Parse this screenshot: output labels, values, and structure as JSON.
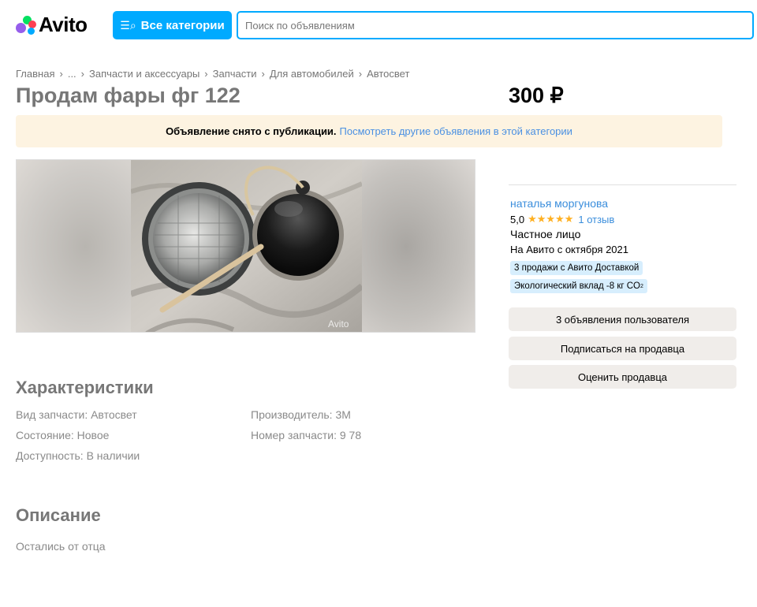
{
  "header": {
    "logo_text": "Avito",
    "categories_label": "Все категории",
    "search_placeholder": "Поиск по объявлениям"
  },
  "breadcrumb": [
    "Главная",
    "...",
    "Запчасти и аксессуары",
    "Запчасти",
    "Для автомобилей",
    "Автосвет"
  ],
  "listing": {
    "title": "Продам фары фг 122",
    "price": "300 ₽"
  },
  "notice": {
    "text": "Объявление снято с публикации.",
    "link": "Посмотреть другие объявления в этой категории"
  },
  "gallery": {
    "watermark": "Avito"
  },
  "seller": {
    "name": "наталья моргунова",
    "rating": "5,0",
    "stars": "★★★★★",
    "reviews": "1 отзыв",
    "type": "Частное лицо",
    "since": "На Авито с октября 2021",
    "badge_delivery": "3 продажи с Авито Доставкой",
    "badge_eco_prefix": "Экологический вклад -8 кг CO",
    "badge_eco_sub": "2",
    "buttons": {
      "ads": "3 объявления пользователя",
      "subscribe": "Подписаться на продавца",
      "rate": "Оценить продавца"
    }
  },
  "characteristics": {
    "heading": "Характеристики",
    "items": [
      "Вид запчасти: Автосвет",
      "Состояние: Новое",
      "Доступность: В наличии",
      "Производитель: 3M",
      "Номер запчасти: 9 78"
    ]
  },
  "description": {
    "heading": "Описание",
    "text": "Остались от отца"
  },
  "colors": {
    "accent": "#00aaff",
    "link": "#3b8edc",
    "star": "#ffb021",
    "notice_bg": "#fdf3e1",
    "badge_bg": "#d7eefd",
    "button_bg": "#f0edea"
  }
}
